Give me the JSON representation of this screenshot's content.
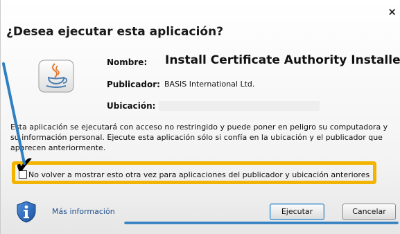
{
  "dialog": {
    "close_symbol": "×",
    "heading": "¿Desea ejecutar esta aplicación?",
    "icon": "java-coffee-cup-icon",
    "fields": {
      "name_label": "Nombre:",
      "name_value": "Install Certificate Authority Installer",
      "publisher_label": "Publicador:",
      "publisher_value": "BASIS International Ltd.",
      "location_label": "Ubicación:"
    },
    "warning_text": "Esta aplicación se ejecutará con acceso no restringido y puede poner en peligro su computadora y su información personal. Ejecute esta aplicación sólo si confía en la ubicación y el publicador que aparecen anteriormente.",
    "checkbox": {
      "label": "No volver a mostrar esto otra vez para aplicaciones del publicador y ubicación anteriores",
      "checked": true,
      "mark": "✔"
    },
    "footer": {
      "more_info": "Más información",
      "info_icon": "shield-info-icon",
      "run_button": "Ejecutar",
      "cancel_button": "Cancelar"
    }
  },
  "colors": {
    "highlight": "#f3b400",
    "annotation_arrow": "#2f7fc1",
    "link": "#1f4e8c"
  }
}
